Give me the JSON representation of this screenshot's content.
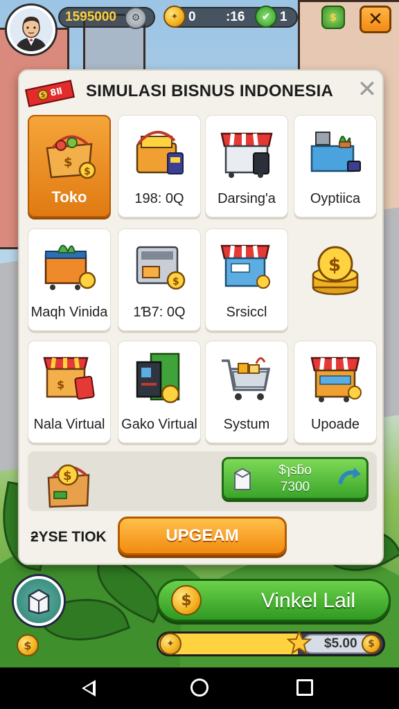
{
  "hud": {
    "money": "1595000",
    "gems": "0",
    "timer": ":16",
    "badge": "1",
    "close_symbol": "✕"
  },
  "dialog": {
    "title": "SIMULASI BISNUS INDONESIA",
    "tag_text": "8Ⅱ",
    "close_symbol": "✕",
    "tiles": [
      {
        "label": "Toko",
        "icon": "shopping-basket-icon",
        "active": true
      },
      {
        "label": "198: 0Q",
        "icon": "cash-register-icon",
        "active": false
      },
      {
        "label": "Darsing'a",
        "icon": "market-stall-icon",
        "active": false
      },
      {
        "label": "Oyptiica",
        "icon": "plant-cart-icon",
        "active": false
      },
      {
        "label": "Maqh Vinida",
        "icon": "veggie-cart-icon",
        "active": false
      },
      {
        "label": "1Ɓ7: 0Q",
        "icon": "printer-icon",
        "active": false
      },
      {
        "label": "Srsiccl",
        "icon": "kiosk-icon",
        "active": false
      },
      {
        "label": "",
        "icon": "coin-stack-icon",
        "active": false
      },
      {
        "label": "Nala Virtual",
        "icon": "box-shop-icon",
        "active": false
      },
      {
        "label": "Gako Virtual",
        "icon": "atm-machine-icon",
        "active": false
      },
      {
        "label": "Systum",
        "icon": "shopping-cart-icon",
        "active": false
      },
      {
        "label": "Upoade",
        "icon": "food-stall-icon",
        "active": false
      }
    ],
    "reward_button": {
      "line1": "$ɿsƃo",
      "line2": "7300"
    },
    "footer_label": "ƻYSE TIOK",
    "upgrade_label": "UPGEAM"
  },
  "bottom": {
    "main_button": "Vinkel Lail",
    "money": "$5.00",
    "xp_progress": 0.62
  },
  "colors": {
    "accent_orange": "#f28a10",
    "accent_green": "#3aa52a",
    "dialog_bg": "#f4f1ea"
  }
}
